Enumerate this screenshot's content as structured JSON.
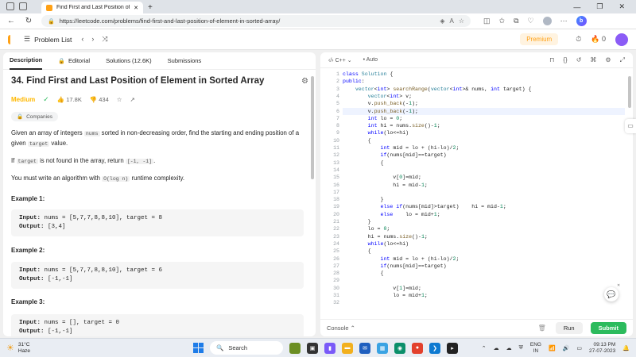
{
  "browser": {
    "tab_title": "Find First and Last Position of El",
    "url": "https://leetcode.com/problems/find-first-and-last-position-of-element-in-sorted-array/"
  },
  "header": {
    "problem_list": "Problem List",
    "premium": "Premium",
    "notifications": "0"
  },
  "left_tabs": [
    {
      "label": "Description"
    },
    {
      "label": "Editorial"
    },
    {
      "label": "Solutions (12.6K)"
    },
    {
      "label": "Submissions"
    }
  ],
  "problem": {
    "title": "34. Find First and Last Position of Element in Sorted Array",
    "difficulty": "Medium",
    "likes": "17.8K",
    "dislikes": "434",
    "companies": "Companies",
    "p1_a": "Given an array of integers ",
    "p1_code1": "nums",
    "p1_b": " sorted in non-decreasing order, find the starting and ending position of a given ",
    "p1_code2": "target",
    "p1_c": " value.",
    "p2_a": "If ",
    "p2_code1": "target",
    "p2_b": " is not found in the array, return ",
    "p2_code2": "[-1, -1]",
    "p2_c": ".",
    "p3_a": "You must write an algorithm with ",
    "p3_code": "O(log n)",
    "p3_b": " runtime complexity."
  },
  "examples": [
    {
      "heading": "Example 1:",
      "input_label": "Input:",
      "input": " nums = [5,7,7,8,8,10], target = 8",
      "output_label": "Output:",
      "output": " [3,4]"
    },
    {
      "heading": "Example 2:",
      "input_label": "Input:",
      "input": " nums = [5,7,7,8,8,10], target = 6",
      "output_label": "Output:",
      "output": " [-1,-1]"
    },
    {
      "heading": "Example 3:",
      "input_label": "Input:",
      "input": " nums = [], target = 0",
      "output_label": "Output:",
      "output": " [-1,-1]"
    }
  ],
  "editor": {
    "language": "C++",
    "mode": "Auto",
    "active_line": 6,
    "lines": [
      "class Solution {",
      "public:",
      "    vector<int> searchRange(vector<int>& nums, int target) {",
      "        vector<int> v;",
      "        v.push_back(-1);",
      "        v.push_back(-1);",
      "        int lo = 0;",
      "        int hi = nums.size()-1;",
      "        while(lo<=hi)",
      "        {",
      "            int mid = lo + (hi-lo)/2;",
      "            if(nums[mid]==target)",
      "            {",
      "",
      "                v[0]=mid;",
      "                hi = mid-1;",
      "",
      "            }",
      "            else if(nums[mid]>target)    hi = mid-1;",
      "            else    lo = mid+1;",
      "        }",
      "        lo = 0;",
      "        hi = nums.size()-1;",
      "        while(lo<=hi)",
      "        {",
      "            int mid = lo + (hi-lo)/2;",
      "            if(nums[mid]==target)",
      "            {",
      "",
      "                v[1]=mid;",
      "                lo = mid+1;",
      ""
    ]
  },
  "footer": {
    "console": "Console",
    "run": "Run",
    "submit": "Submit"
  },
  "taskbar": {
    "temp": "31°C",
    "weather": "Haze",
    "search": "Search",
    "lang1": "ENG",
    "lang2": "IN",
    "time": "09:13 PM",
    "date": "27-07-2023"
  },
  "colors": {
    "accent": "#ffa116",
    "medium": "#ffb800",
    "submit": "#2cbb5d"
  }
}
